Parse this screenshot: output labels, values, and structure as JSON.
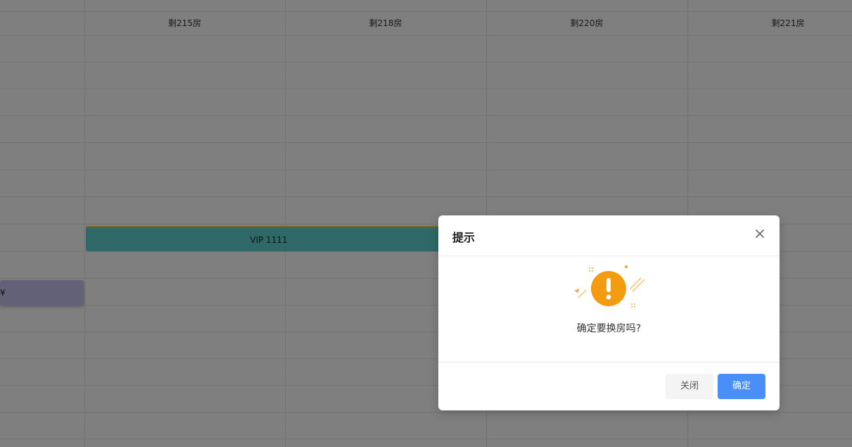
{
  "calendar": {
    "columns": [
      {
        "label": "剩215房"
      },
      {
        "label": "剩218房"
      },
      {
        "label": "剩220房"
      },
      {
        "label": "剩221房"
      }
    ],
    "bookings": {
      "vip": {
        "label": "VIP 1111",
        "color": "#5fd3cf"
      },
      "purple": {
        "label": "¥",
        "color": "#c5c2f0"
      }
    }
  },
  "dialog": {
    "title": "提示",
    "message": "确定要换房吗?",
    "icon": "warning-exclamation-icon",
    "icon_color": "#f39c12",
    "cancel_label": "关闭",
    "confirm_label": "确定",
    "confirm_color": "#4a8ff7"
  }
}
